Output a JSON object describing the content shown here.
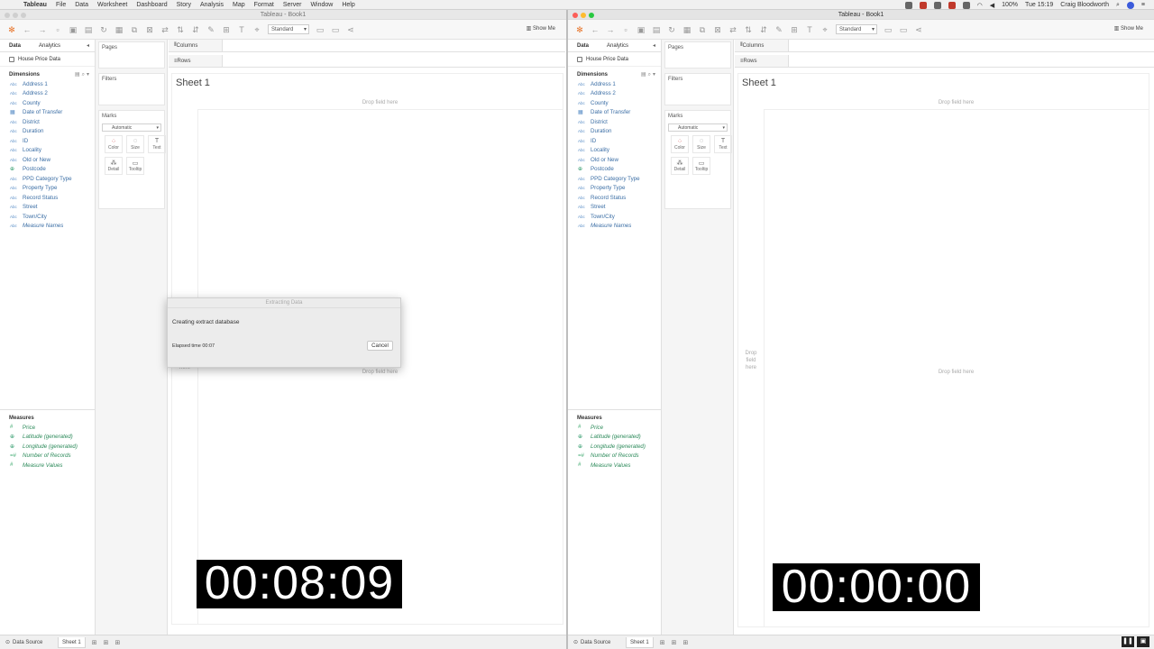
{
  "menubar": {
    "app": "Tableau",
    "items": [
      "File",
      "Data",
      "Worksheet",
      "Dashboard",
      "Story",
      "Analysis",
      "Map",
      "Format",
      "Server",
      "Window",
      "Help"
    ],
    "battery": "100%",
    "clock": "Tue 15:19",
    "user": "Craig Bloodworth"
  },
  "left": {
    "window_title": "Tableau - Book1",
    "toolbar": {
      "fit_select": "Standard",
      "show_me": "Show Me"
    },
    "data_tabs": {
      "data": "Data",
      "analytics": "Analytics"
    },
    "datasource": "House Price Data",
    "dimensions_label": "Dimensions",
    "dimensions": [
      {
        "type": "Abc",
        "name": "Address 1"
      },
      {
        "type": "Abc",
        "name": "Address 2"
      },
      {
        "type": "Abc",
        "name": "County"
      },
      {
        "type": "cal",
        "name": "Date of Transfer"
      },
      {
        "type": "Abc",
        "name": "District"
      },
      {
        "type": "Abc",
        "name": "Duration"
      },
      {
        "type": "Abc",
        "name": "ID"
      },
      {
        "type": "Abc",
        "name": "Locality"
      },
      {
        "type": "Abc",
        "name": "Old or New"
      },
      {
        "type": "geo",
        "name": "Postcode"
      },
      {
        "type": "Abc",
        "name": "PPD Category Type"
      },
      {
        "type": "Abc",
        "name": "Property Type"
      },
      {
        "type": "Abc",
        "name": "Record Status"
      },
      {
        "type": "Abc",
        "name": "Street"
      },
      {
        "type": "Abc",
        "name": "Town/City"
      },
      {
        "type": "Abc",
        "name": "Measure Names"
      }
    ],
    "measures_label": "Measures",
    "measures": [
      {
        "type": "#",
        "name": "Price"
      },
      {
        "type": "geo",
        "name": "Latitude (generated)"
      },
      {
        "type": "geo",
        "name": "Longitude (generated)"
      },
      {
        "type": "=#",
        "name": "Number of Records"
      },
      {
        "type": "#",
        "name": "Measure Values"
      }
    ],
    "cards": {
      "pages": "Pages",
      "filters": "Filters",
      "marks": "Marks",
      "mark_type": "Automatic",
      "mark_buttons": [
        "Color",
        "Size",
        "Text",
        "Detail",
        "Tooltip"
      ]
    },
    "shelves": {
      "columns": "Columns",
      "rows": "Rows"
    },
    "sheet_title": "Sheet 1",
    "drop_field": "Drop field here",
    "drop_field_left": "Drop field here",
    "dialog": {
      "title": "Extracting Data",
      "message": "Creating extract database",
      "elapsed": "Elapsed time 00:07",
      "cancel": "Cancel"
    },
    "timer": "00:08:09",
    "tabs": {
      "data_source": "Data Source",
      "sheet": "Sheet 1"
    }
  },
  "right": {
    "window_title": "Tableau - Book1",
    "toolbar": {
      "fit_select": "Standard",
      "show_me": "Show Me"
    },
    "data_tabs": {
      "data": "Data",
      "analytics": "Analytics"
    },
    "datasource": "House Price Data",
    "dimensions_label": "Dimensions",
    "measures_label": "Measures",
    "cards": {
      "pages": "Pages",
      "filters": "Filters",
      "marks": "Marks",
      "mark_type": "Automatic"
    },
    "shelves": {
      "columns": "Columns",
      "rows": "Rows"
    },
    "sheet_title": "Sheet 1",
    "drop_field": "Drop field here",
    "drop_field_left": "Drop field here",
    "timer": "00:00:00",
    "tabs": {
      "data_source": "Data Source",
      "sheet": "Sheet 1"
    }
  },
  "colors": {
    "dimension": "#3b6ea5",
    "measure": "#2c8a5a",
    "accent": "#e8762c"
  }
}
